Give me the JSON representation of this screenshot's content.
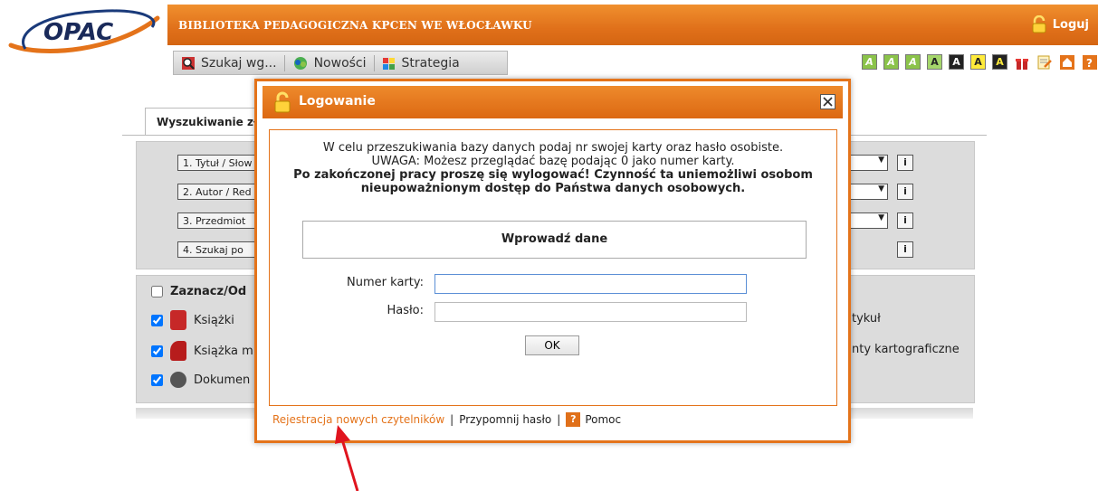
{
  "header": {
    "logo_text": "OPAC",
    "site_title": "BIBLIOTEKA PEDAGOGICZNA KPCEN WE WŁOCŁAWKU",
    "login_label": "Loguj"
  },
  "nav": {
    "items": [
      {
        "label": "Szukaj wg...",
        "icon": "search-icon"
      },
      {
        "label": "Nowości",
        "icon": "news-icon"
      },
      {
        "label": "Strategia",
        "icon": "strategy-icon"
      }
    ],
    "toolbar_letters": [
      "A",
      "A",
      "A",
      "A",
      "A",
      "A",
      "A"
    ]
  },
  "search_page": {
    "tab_label": "Wyszukiwanie zł",
    "criteria": [
      "1. Tytuł / Słow",
      "2. Autor / Red",
      "3. Przedmiot",
      "4. Szukaj po"
    ],
    "info_label": "i",
    "select_arrow": "▼",
    "select_all_label": "Zaznacz/Od",
    "types_left": [
      "Książki",
      "Książka m",
      "Dokumen"
    ],
    "types_right": [
      "tykuł",
      "nty kartograficzne"
    ]
  },
  "modal": {
    "title": "Logowanie",
    "close_label": "×",
    "info_line1": "W celu przeszukiwania bazy danych podaj nr swojej karty oraz hasło osobiste.",
    "info_line2": "UWAGA: Możesz przeglądać bazę podając 0 jako numer karty.",
    "info_line3": "Po zakończonej pracy proszę się wylogować! Czynność ta uniemożliwi osobom",
    "info_line4": "nieupoważnionym dostęp do Państwa danych osobowych.",
    "form_heading": "Wprowadź dane",
    "card_label": "Numer karty:",
    "card_value": "",
    "password_label": "Hasło:",
    "password_value": "",
    "ok_label": "OK",
    "footer": {
      "register_label": "Rejestracja nowych czytelników",
      "separator": "|",
      "remind_label": "Przypomnij hasło",
      "help_label": "Pomoc",
      "help_icon_text": "?"
    }
  },
  "colors": {
    "accent": "#e4731a",
    "arrow": "#e0141e",
    "panel_gray": "#dcdcdc"
  }
}
